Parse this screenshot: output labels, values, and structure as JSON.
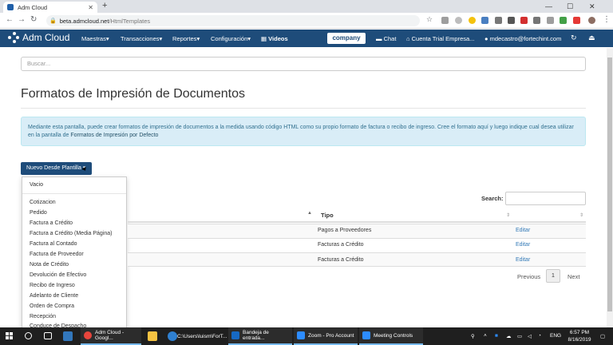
{
  "browser": {
    "tab_title": "Adm Cloud",
    "url_host": "beta.admcloud.net",
    "url_path": "/HtmlTemplates"
  },
  "navbar": {
    "brand": "Adm Cloud",
    "menus": [
      "Maestras",
      "Transacciones",
      "Reportes",
      "Configuración"
    ],
    "videos": "Videos",
    "company_logo": "company",
    "chat": "Chat",
    "account": "Cuenta Trial Empresa...",
    "user": "mdecastro@fortechint.com"
  },
  "search": {
    "placeholder": "Buscar..."
  },
  "page": {
    "title": "Formatos de Impresión de Documentos",
    "info_text": "Mediante esta pantalla, puede crear formatos de impresión de documentos a la medida usando código HTML como su propio formato de factura o recibo de ingreso. Cree el formato aquí y luego indique cual desea utilizar en la pantalla de",
    "info_link": "Formatos de Impresión por Defecto"
  },
  "new_button": {
    "label": "Nuevo Desde Plantilla"
  },
  "dropdown": {
    "first": "Vacio",
    "items": [
      "Cotizacion",
      "Pedido",
      "Factura a Crédito",
      "Factura a Crédito (Media Página)",
      "Factura al Contado",
      "Factura de Proveedor",
      "Nota de Crédito",
      "Devolución de Efectivo",
      "Recibo de Ingreso",
      "Adelanto de Cliente",
      "Orden de Compra",
      "Recepción",
      "Conduce de Despacho"
    ]
  },
  "table": {
    "search_label": "Search:",
    "col_tipo": "Tipo",
    "rows": [
      {
        "tipo": "Pagos a Proveedores",
        "action": "Editar"
      },
      {
        "tipo": "Facturas a Crédito",
        "action": "Editar"
      },
      {
        "tipo": "Facturas a Crédito",
        "action": "Editar"
      }
    ],
    "pager": {
      "previous": "Previous",
      "page": "1",
      "next": "Next"
    }
  },
  "taskbar": {
    "tasks": [
      "Adm Cloud - Googl...",
      "C:\\Users\\luism\\ForT...",
      "Bandeja de entrada...",
      "Zoom - Pro Account",
      "Meeting Controls"
    ],
    "lang": "ENG",
    "time": "6:57 PM",
    "date": "8/16/2019"
  }
}
